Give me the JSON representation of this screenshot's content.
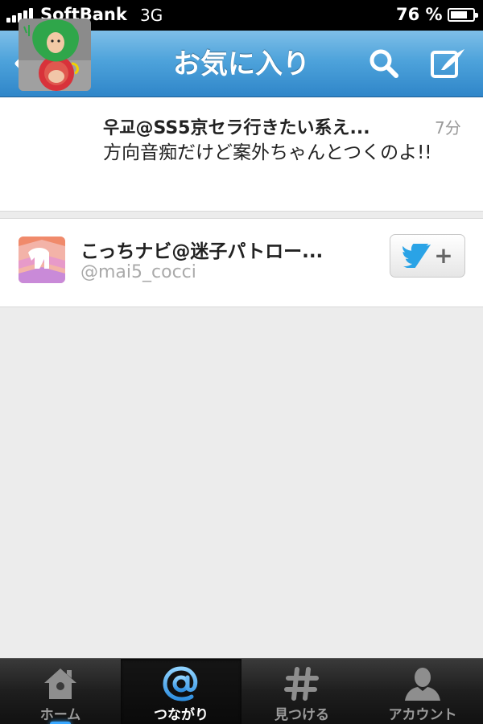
{
  "status_bar": {
    "carrier": "SoftBank",
    "network": "3G",
    "battery_percent_label": "76 %",
    "battery_level": 0.76,
    "signal_bars": 5
  },
  "nav": {
    "title": "お気に入り",
    "icons": {
      "back": "back-arrow-icon",
      "search": "search-icon",
      "compose": "compose-icon"
    }
  },
  "tweet": {
    "name": "우교@SS5京セラ行きたい系え...",
    "time": "7分",
    "text": "方向音痴だけど案外ちゃんとつくのよ!!"
  },
  "user": {
    "name": "こっちナビ@迷子パトロー...",
    "handle": "@mai5_cocci",
    "follow_icon": "twitter-bird-plus-icon"
  },
  "tabs": [
    {
      "label": "ホーム",
      "icon": "home-icon",
      "active": false
    },
    {
      "label": "つながり",
      "icon": "at-icon",
      "active": true
    },
    {
      "label": "見つける",
      "icon": "hash-icon",
      "active": false
    },
    {
      "label": "アカウント",
      "icon": "person-icon",
      "active": false
    }
  ],
  "colors": {
    "nav_blue": "#4ea3db",
    "twitter_blue": "#2aa3e6",
    "background": "#ececec"
  }
}
